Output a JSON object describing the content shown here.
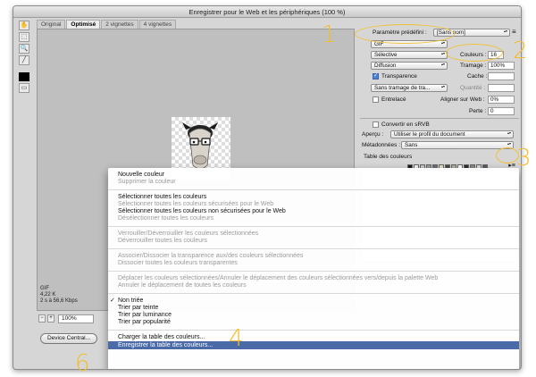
{
  "window": {
    "title": "Enregistrer pour le Web et les périphériques (100 %)"
  },
  "tabs": [
    {
      "label": "Original"
    },
    {
      "label": "Optimisé"
    },
    {
      "label": "2 vignettes"
    },
    {
      "label": "4 vignettes"
    }
  ],
  "tools": [
    "hand-icon",
    "slice-select-icon",
    "zoom-icon",
    "eyedropper-icon"
  ],
  "preview": {
    "info_lines": [
      "GIF",
      "4,22 K",
      "2 s à 56,6 Kbps"
    ],
    "zoom": "100%"
  },
  "device_button": "Device Central...",
  "panel": {
    "preset_label": "Paramètre prédéfini :",
    "preset_value": "[Sans nom]",
    "format": "GIF",
    "reduction": "Sélective",
    "dither": "Diffusion",
    "colors_label": "Couleurs :",
    "colors_value": "16",
    "dither_amount_label": "Tramage :",
    "dither_amount_value": "100%",
    "transparency_label": "Transparence",
    "matte_label": "Cache :",
    "trans_dither": "Sans tramage de tra...",
    "amount_label": "Quantité :",
    "interlaced_label": "Entrelacé",
    "web_snap_label": "Aligner sur Web :",
    "web_snap_value": "0%",
    "lossy_label": "Perte :",
    "lossy_value": "0",
    "srgb_label": "Convertir en sRVB",
    "preview_label": "Aperçu :",
    "preview_value": "Utiliser le profil du document",
    "metadata_label": "Métadonnées :",
    "metadata_value": "Sans",
    "color_table_label": "Table des couleurs"
  },
  "swatches": [
    "#1a1a1a",
    "#f4f4f4",
    "#c8c8c8",
    "#9a9a9a",
    "#6e6e6e",
    "#e8e0c8",
    "#4a4a4a",
    "#b8b0a0",
    "#ffffff",
    "#2c2c2c",
    "#8c8a7c",
    "#dcdcdc",
    "#5a5a5a"
  ],
  "annotations": {
    "one": "1",
    "two": "2",
    "three": "3",
    "four": "4",
    "six": "6"
  },
  "accent_color": "#f3bd2d",
  "menu": {
    "items": [
      {
        "label": "Nouvelle couleur",
        "state": "enabled"
      },
      {
        "label": "Supprimer la couleur",
        "state": "disabled"
      },
      {
        "sep": true
      },
      {
        "label": "Sélectionner toutes les couleurs",
        "state": "enabled"
      },
      {
        "label": "Sélectionner toutes les couleurs sécurisées pour le Web",
        "state": "disabled"
      },
      {
        "label": "Sélectionner toutes les couleurs non sécurisées pour le Web",
        "state": "enabled"
      },
      {
        "label": "Désélectionner toutes les couleurs",
        "state": "disabled"
      },
      {
        "sep": true
      },
      {
        "label": "Verrouiller/Déverrouiller les couleurs sélectionnées",
        "state": "disabled"
      },
      {
        "label": "Déverrouiller toutes les couleurs",
        "state": "disabled"
      },
      {
        "sep": true
      },
      {
        "label": "Associer/Dissocier la transparence aux/des couleurs sélectionnées",
        "state": "disabled"
      },
      {
        "label": "Dissocier toutes les couleurs transparentes",
        "state": "disabled"
      },
      {
        "sep": true
      },
      {
        "label": "Déplacer les couleurs sélectionnées/Annuler le déplacement des couleurs sélectionnées vers/depuis la palette Web",
        "state": "disabled"
      },
      {
        "label": "Annuler le déplacement de toutes les couleurs",
        "state": "disabled"
      },
      {
        "sep": true
      },
      {
        "label": "Non triée",
        "state": "enabled",
        "checked": true
      },
      {
        "label": "Trier par teinte",
        "state": "enabled"
      },
      {
        "label": "Trier par luminance",
        "state": "enabled"
      },
      {
        "label": "Trier par popularité",
        "state": "enabled"
      },
      {
        "sep": true
      },
      {
        "label": "Charger la table des couleurs...",
        "state": "enabled"
      },
      {
        "label": "Enregistrer la table des couleurs...",
        "state": "selected"
      }
    ]
  }
}
